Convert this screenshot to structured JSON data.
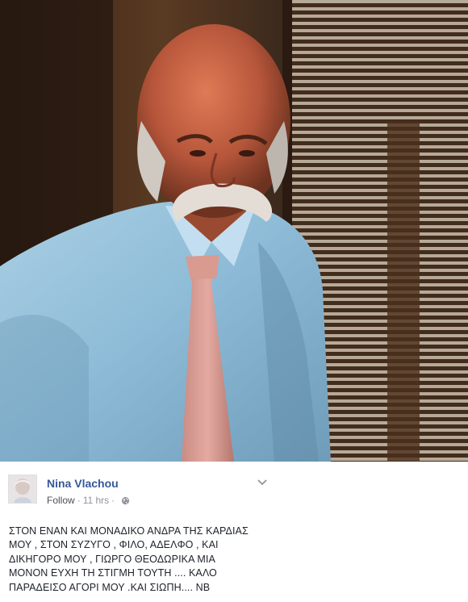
{
  "post": {
    "author_name": "Nina Vlachou",
    "follow_label": "Follow",
    "separator": "·",
    "timestamp": "11 hrs",
    "text": "ΣΤΟΝ ΕΝΑΝ ΚΑΙ ΜΟΝΑΔΙΚΟ ΑΝΔΡΑ ΤΗΣ ΚΑΡΔΙΑΣ\nΜΟΥ , ΣΤΟΝ ΣΥΖΥΓΟ , ΦΙΛΟ, ΑΔΕΛΦΟ , ΚΑΙ\nΔΙΚΗΓΟΡΟ ΜΟΥ , ΓΙΩΡΓΟ ΘΕΟΔΩΡΙΚΑ ΜΙΑ\nΜΟΝΟΝ ΕΥΧΗ ΤΗ ΣΤΙΓΜΗ ΤΟΥΤΗ .... ΚΑΛΟ\nΠΑΡΑΔΕΙΣΟ ΑΓΟΡΙ ΜΟΥ .ΚΑΙ ΣΙΩΠΗ.... ΝΒ",
    "privacy_icon": "globe-icon",
    "options_icon": "chevron-down-icon"
  },
  "colors": {
    "author_link": "#365899",
    "meta_text": "#90949c",
    "body_text": "#1d2129"
  }
}
